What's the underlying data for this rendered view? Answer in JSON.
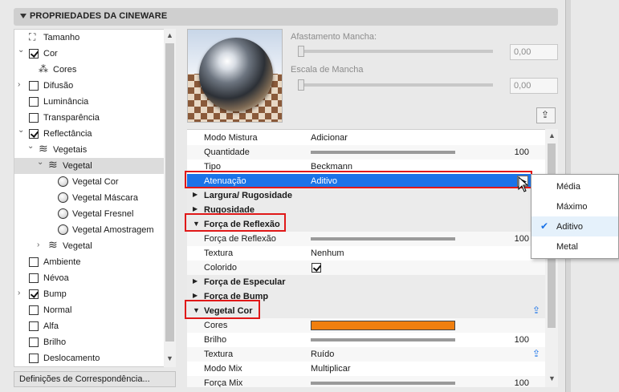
{
  "panel": {
    "title": "PROPRIEDADES DA CINEWARE",
    "mapping_button": "Definições de Correspondência..."
  },
  "tree": {
    "items": [
      {
        "label": "Tamanho",
        "kind": "icon",
        "icon": "resize-icon"
      },
      {
        "label": "Cor",
        "kind": "checkbox",
        "checked": true,
        "expanded": true
      },
      {
        "label": "Cores",
        "kind": "icon",
        "icon": "colors-icon"
      },
      {
        "label": "Difusão",
        "kind": "checkbox",
        "checked": false,
        "expanded": false
      },
      {
        "label": "Luminância",
        "kind": "checkbox",
        "checked": false
      },
      {
        "label": "Transparência",
        "kind": "checkbox",
        "checked": false
      },
      {
        "label": "Reflectância",
        "kind": "checkbox",
        "checked": true,
        "expanded": true
      },
      {
        "label": "Vegetais",
        "kind": "layers",
        "expanded": true
      },
      {
        "label": "Vegetal",
        "kind": "layers",
        "expanded": true,
        "selected": true
      },
      {
        "label": "Vegetal Cor",
        "kind": "radio"
      },
      {
        "label": "Vegetal Máscara",
        "kind": "radio"
      },
      {
        "label": "Vegetal Fresnel",
        "kind": "radio"
      },
      {
        "label": "Vegetal Amostragem",
        "kind": "radio"
      },
      {
        "label": "Vegetal",
        "kind": "layers",
        "expanded": false
      },
      {
        "label": "Ambiente",
        "kind": "checkbox",
        "checked": false
      },
      {
        "label": "Névoa",
        "kind": "checkbox",
        "checked": false
      },
      {
        "label": "Bump",
        "kind": "checkbox",
        "checked": true,
        "expanded": false
      },
      {
        "label": "Normal",
        "kind": "checkbox",
        "checked": false
      },
      {
        "label": "Alfa",
        "kind": "checkbox",
        "checked": false
      },
      {
        "label": "Brilho",
        "kind": "checkbox",
        "checked": false
      },
      {
        "label": "Deslocamento",
        "kind": "checkbox",
        "checked": false
      }
    ]
  },
  "top_controls": {
    "afastamento_label": "Afastamento Mancha:",
    "afastamento_value": "0,00",
    "escala_label": "Escala de Mancha",
    "escala_value": "0,00"
  },
  "grid": {
    "rows": [
      {
        "type": "text",
        "name": "Modo Mistura",
        "value": "Adicionar"
      },
      {
        "type": "slider",
        "name": "Quantidade",
        "value": "100",
        "fraction": 1.0
      },
      {
        "type": "text",
        "name": "Tipo",
        "value": "Beckmann"
      },
      {
        "type": "dropdown",
        "name": "Atenuação",
        "value": "Aditivo",
        "highlighted": true
      },
      {
        "type": "group",
        "name": "Largura/ Rugosidade",
        "open": false
      },
      {
        "type": "group",
        "name": "Rugosidade",
        "open": false
      },
      {
        "type": "group",
        "name": "Força de Reflexão",
        "open": true
      },
      {
        "type": "slider",
        "name": "Força de Reflexão",
        "value": "100",
        "fraction": 1.0
      },
      {
        "type": "text",
        "name": "Textura",
        "value": "Nenhum"
      },
      {
        "type": "check",
        "name": "Colorido",
        "checked": true
      },
      {
        "type": "group",
        "name": "Força de Especular",
        "open": false
      },
      {
        "type": "group",
        "name": "Força de Bump",
        "open": false
      },
      {
        "type": "group",
        "name": "Vegetal Cor",
        "open": true,
        "icon": true
      },
      {
        "type": "color",
        "name": "Cores",
        "color": "#f07f0f"
      },
      {
        "type": "slider",
        "name": "Brilho",
        "value": "100",
        "fraction": 1.0
      },
      {
        "type": "text",
        "name": "Textura",
        "value": "Ruído",
        "icon": true
      },
      {
        "type": "text",
        "name": "Modo Mix",
        "value": "Multiplicar"
      },
      {
        "type": "slider",
        "name": "Força Mix",
        "value": "100",
        "fraction": 1.0
      }
    ]
  },
  "dropdown_menu": {
    "options": [
      "Média",
      "Máximo",
      "Aditivo",
      "Metal"
    ],
    "selected": "Aditivo"
  },
  "colors": {
    "highlight": "#1a73e8",
    "annotation": "#e01818",
    "swatch": "#f07f0f"
  }
}
